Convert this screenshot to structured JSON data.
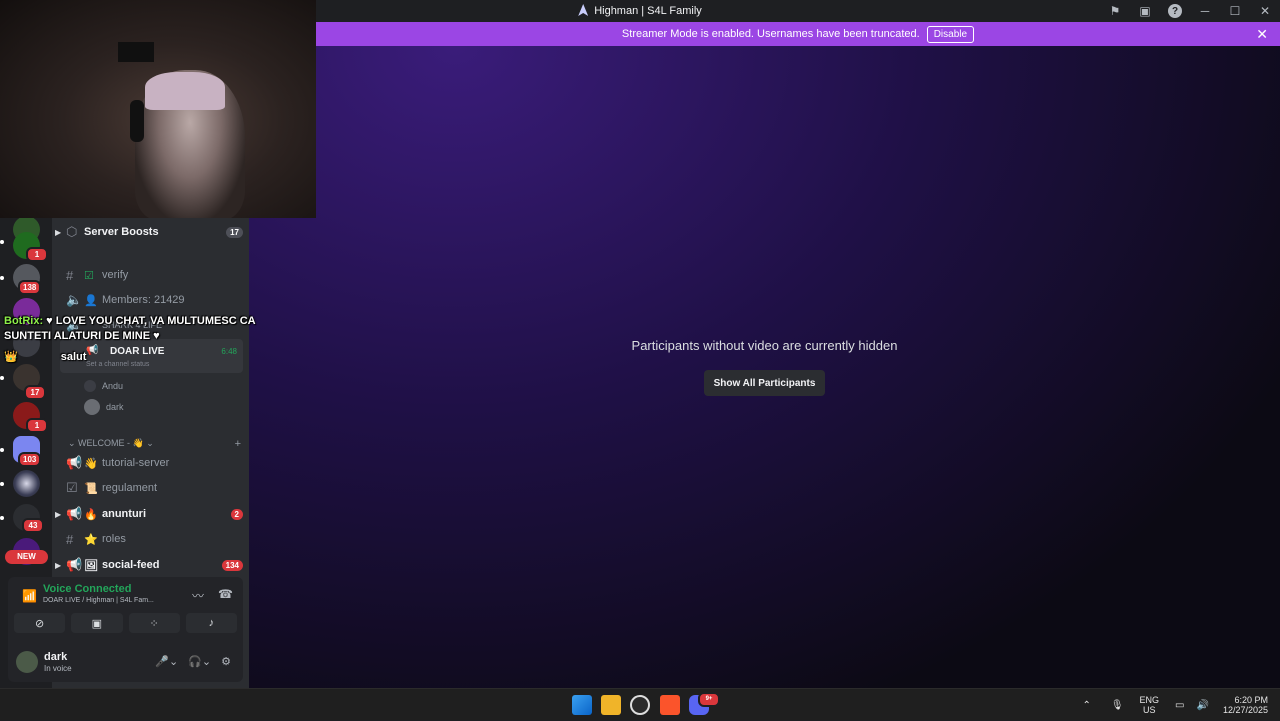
{
  "window": {
    "title": "Highman | S4L Family"
  },
  "banner": {
    "text": "Streamer Mode is enabled. Usernames have been truncated.",
    "button": "Disable"
  },
  "servers": {
    "badges": [
      "1",
      "138",
      "17",
      "1",
      "103",
      "43"
    ],
    "new_label": "NEW"
  },
  "channels": {
    "server_boosts": {
      "label": "Server Boosts",
      "count": "17"
    },
    "verify": "verify",
    "members": "Members: 21429",
    "hidden_channel": "SHARK 4 LIFE",
    "voice": {
      "name": "DOAR LIVE",
      "time": "6:48",
      "status": "Set a channel status"
    },
    "voice_users": [
      "Andu",
      "dark"
    ],
    "category": "WELCOME -",
    "list": [
      {
        "name": "tutorial-server",
        "emoji": "👋",
        "bright": false
      },
      {
        "name": "regulament",
        "emoji": "📜",
        "bright": false
      },
      {
        "name": "anunturi",
        "emoji": "🔥",
        "bright": true,
        "badge": "2"
      },
      {
        "name": "roles",
        "emoji": "⭐",
        "bright": false
      },
      {
        "name": "social-feed",
        "emoji": "🖼",
        "bright": true,
        "badge": "134"
      }
    ]
  },
  "voice_panel": {
    "title": "Voice Connected",
    "subtitle": "DOAR LIVE / Highman | S4L Fam..."
  },
  "user": {
    "name": "dark",
    "status": "In voice"
  },
  "overlay_chat": {
    "user1": "BotRix:",
    "msg1": "LOVE YOU CHAT, VA MULTUMESC CA SUNTETI ALATURI DE MINE",
    "msg2": "salut"
  },
  "stage": {
    "message": "Participants without video are currently hidden",
    "button": "Show All Participants"
  },
  "taskbar": {
    "lang_top": "ENG",
    "lang_bottom": "US",
    "time": "6:20 PM",
    "date": "12/27/2025",
    "discord_badge": "9+"
  },
  "colors": {
    "banner": "#9b46e4",
    "online": "#23a55a",
    "badge": "#da373c"
  }
}
